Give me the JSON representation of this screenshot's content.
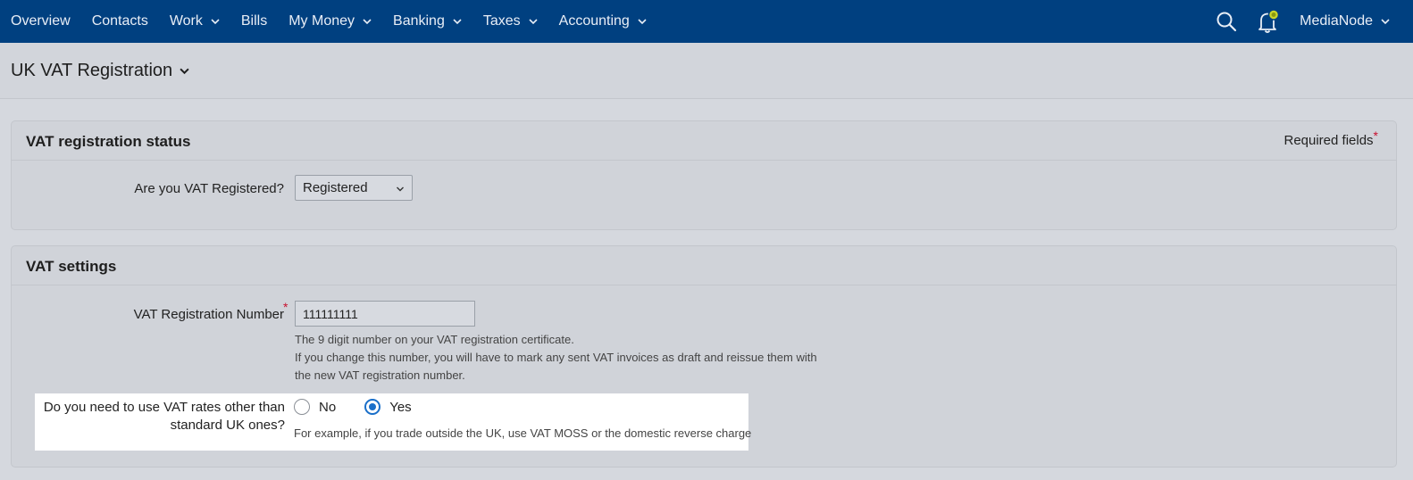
{
  "nav": {
    "items": [
      {
        "label": "Overview",
        "has_dropdown": false
      },
      {
        "label": "Contacts",
        "has_dropdown": false
      },
      {
        "label": "Work",
        "has_dropdown": true
      },
      {
        "label": "Bills",
        "has_dropdown": false
      },
      {
        "label": "My Money",
        "has_dropdown": true
      },
      {
        "label": "Banking",
        "has_dropdown": true
      },
      {
        "label": "Taxes",
        "has_dropdown": true
      },
      {
        "label": "Accounting",
        "has_dropdown": true
      }
    ],
    "account": "MediaNode",
    "icons": {
      "search": "search-icon",
      "bell": "bell-icon",
      "chevron": "chevron-down-icon"
    }
  },
  "page": {
    "title": "UK VAT Registration"
  },
  "status_panel": {
    "title": "VAT registration status",
    "required_note": "Required fields",
    "required_star": "*",
    "question": "Are you VAT Registered?",
    "select_value": "Registered"
  },
  "settings_panel": {
    "title": "VAT settings",
    "reg_number_label": "VAT Registration Number",
    "reg_number_value": "111111111",
    "reg_help_1": "The 9 digit number on your VAT registration certificate.",
    "reg_help_2": "If you change this number, you will have to mark any sent VAT invoices as draft and reissue them with",
    "reg_help_3": "the new VAT registration number.",
    "rates_question_1": "Do you need to use VAT rates other than",
    "rates_question_2": "standard UK ones?",
    "option_no": "No",
    "option_yes": "Yes",
    "selected_option": "Yes",
    "rates_help": "For example, if you trade outside the UK, use VAT MOSS or the domestic reverse charge"
  },
  "colors": {
    "nav_bg": "#004080",
    "accent": "#1a6fc9",
    "required": "#c8102e",
    "bell_badge": "#c9d62a"
  }
}
